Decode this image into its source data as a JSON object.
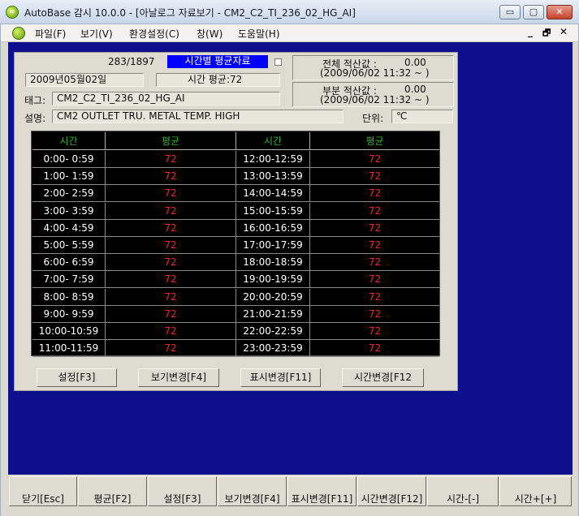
{
  "window": {
    "icon_text": "∞",
    "title": "AutoBase 감시 10.0.0 - [아날로그 자료보기 - CM2_C2_TI_236_02_HG_AI]",
    "min": "▭",
    "max": "▢",
    "close": "✕"
  },
  "menu": {
    "items": [
      "파일(F)",
      "보기(V)",
      "환경설정(C)",
      "창(W)",
      "도움말(H)"
    ],
    "mdi_min": "_",
    "mdi_restore": "🗗",
    "mdi_close": "✕"
  },
  "panel": {
    "counter": "283/1897",
    "mode_badge": "시간별 평균자료",
    "date": "2009년05월02일",
    "hour_avg": "시간 평균:72",
    "tag_label": "태그:",
    "tag_value": "CM2_C2_TI_236_02_HG_AI",
    "desc_label": "설명:",
    "desc_value": "CM2 OUTLET TRU. METAL TEMP. HIGH",
    "unit_label": "단위:",
    "unit_value": "℃",
    "total_label": "전체 적산값 :",
    "total_value": "0.00",
    "total_since": "(2009/06/02 11:32 ~ )",
    "partial_label": "부분 적산값 :",
    "partial_value": "0.00",
    "partial_since": "(2009/06/02 11:32 ~ )"
  },
  "table": {
    "headers": [
      "시간",
      "평균",
      "시간",
      "평균"
    ],
    "left": [
      {
        "time": "0:00- 0:59",
        "val": "72"
      },
      {
        "time": "1:00- 1:59",
        "val": "72"
      },
      {
        "time": "2:00- 2:59",
        "val": "72"
      },
      {
        "time": "3:00- 3:59",
        "val": "72"
      },
      {
        "time": "4:00- 4:59",
        "val": "72"
      },
      {
        "time": "5:00- 5:59",
        "val": "72"
      },
      {
        "time": "6:00- 6:59",
        "val": "72"
      },
      {
        "time": "7:00- 7:59",
        "val": "72"
      },
      {
        "time": "8:00- 8:59",
        "val": "72"
      },
      {
        "time": "9:00- 9:59",
        "val": "72"
      },
      {
        "time": "10:00-10:59",
        "val": "72"
      },
      {
        "time": "11:00-11:59",
        "val": "72"
      }
    ],
    "right": [
      {
        "time": "12:00-12:59",
        "val": "72"
      },
      {
        "time": "13:00-13:59",
        "val": "72"
      },
      {
        "time": "14:00-14:59",
        "val": "72"
      },
      {
        "time": "15:00-15:59",
        "val": "72"
      },
      {
        "time": "16:00-16:59",
        "val": "72"
      },
      {
        "time": "17:00-17:59",
        "val": "72"
      },
      {
        "time": "18:00-18:59",
        "val": "72"
      },
      {
        "time": "19:00-19:59",
        "val": "72"
      },
      {
        "time": "20:00-20:59",
        "val": "72"
      },
      {
        "time": "21:00-21:59",
        "val": "72"
      },
      {
        "time": "22:00-22:59",
        "val": "72"
      },
      {
        "time": "23:00-23:59",
        "val": "72"
      }
    ]
  },
  "panel_buttons": [
    "설정[F3]",
    "보기변경[F4]",
    "표시변경[F11]",
    "시간변경[F12"
  ],
  "function_bar": [
    "닫기[Esc]",
    "평균[F2]",
    "설정[F3]",
    "보기변경[F4]",
    "표시변경[F11]",
    "시간변경[F12]",
    "시간-[-]",
    "시간+[+]"
  ],
  "colors": {
    "mdi_background": "#0d0f8c",
    "table_background": "#000000",
    "header_text": "#2fb52f",
    "value_text": "#ff2020",
    "badge_background": "#0000ff"
  }
}
